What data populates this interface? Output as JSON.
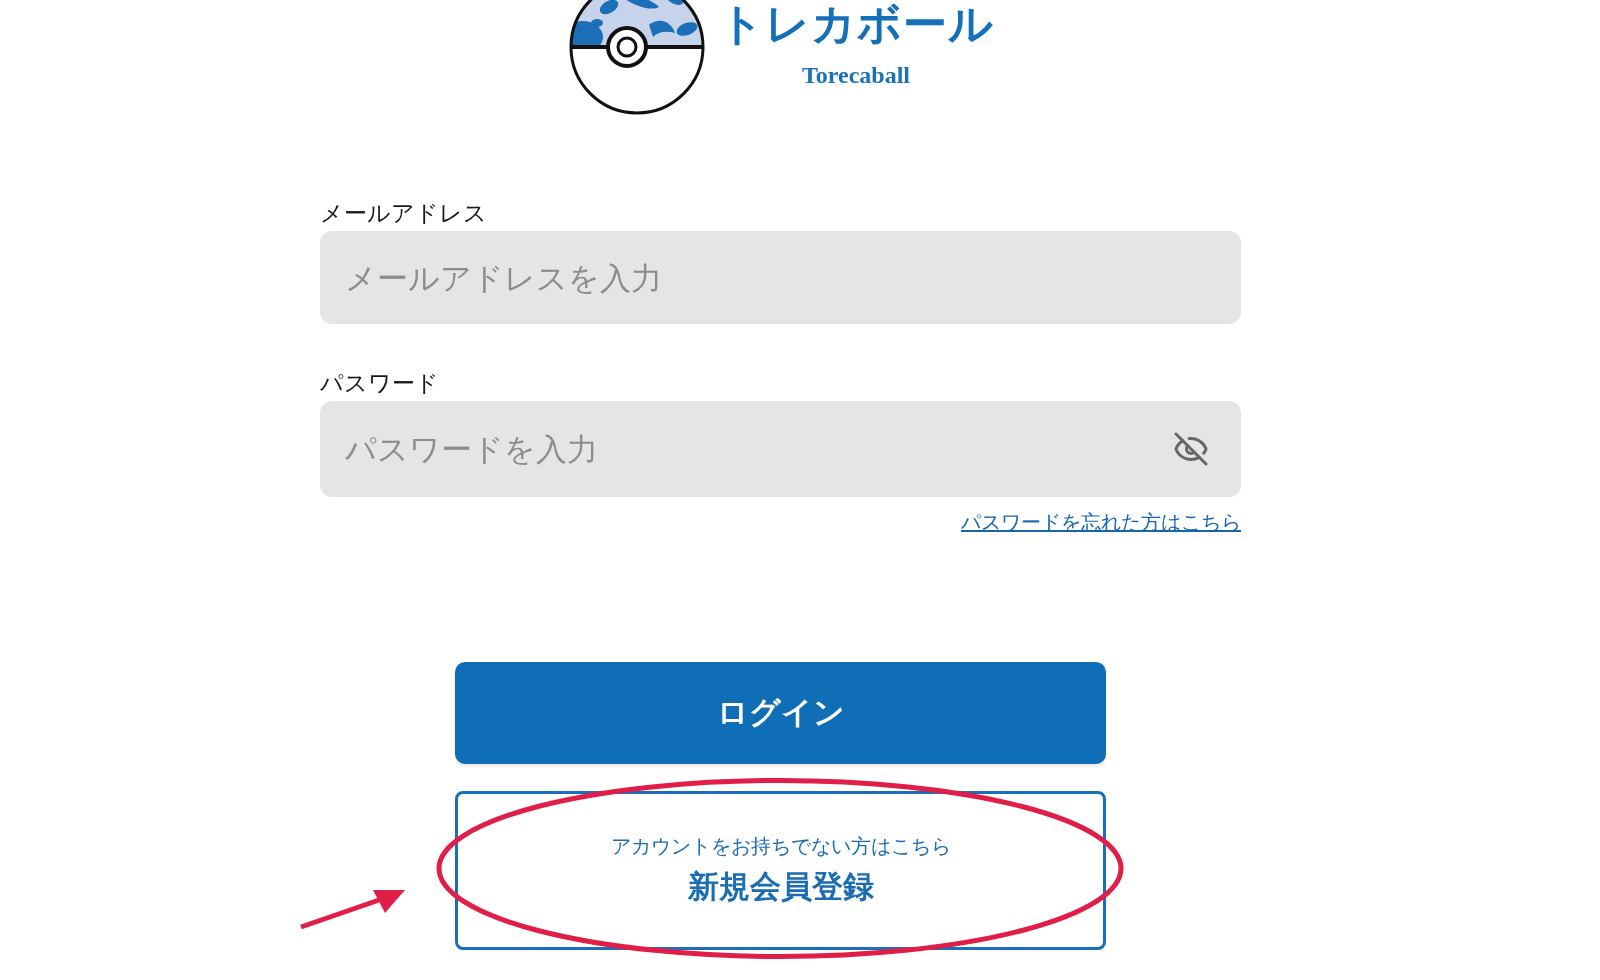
{
  "logo": {
    "title": "トレカボール",
    "subtitle": "Torecaball"
  },
  "form": {
    "fields": [
      {
        "kind": "email",
        "label": "メールアドレス",
        "placeholder": "メールアドレスを入力"
      },
      {
        "kind": "password",
        "label": "パスワード",
        "placeholder": "パスワードを入力",
        "visible": false
      }
    ],
    "forgot_link": "パスワードを忘れた方はこちら"
  },
  "login_button": "ログイン",
  "register_button": {
    "caption": "アカウントをお持ちでない方はこちら",
    "label": "新規会員登録"
  }
}
